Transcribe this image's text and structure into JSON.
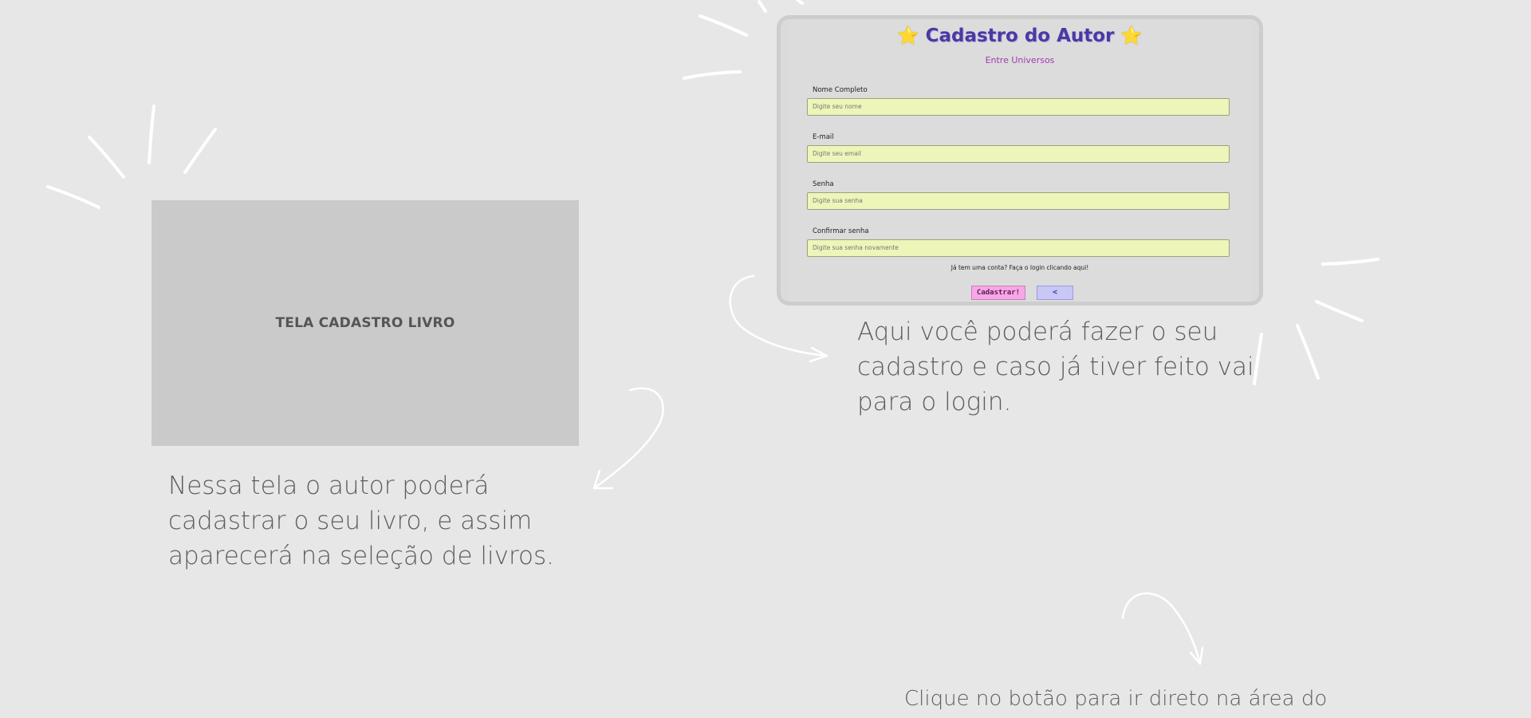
{
  "left_panel": {
    "label": "TELA CADASTRO LIVRO",
    "caption": "Nessa tela o autor poderá cadastrar o seu livro, e assim aparecerá na seleção de livros."
  },
  "preview": {
    "title": "Cadastro do Autor",
    "star_left": "⭐",
    "star_right": "⭐",
    "subtitle": "Entre Universos",
    "fields": [
      {
        "label": "Nome Completo",
        "placeholder": "Digite seu nome"
      },
      {
        "label": "E-mail",
        "placeholder": "Digite seu email"
      },
      {
        "label": "Senha",
        "placeholder": "Digite sua senha"
      },
      {
        "label": "Confirmar senha",
        "placeholder": "Digite sua senha novamente"
      }
    ],
    "login_hint": "Já tem uma conta? Faça o login clicando aqui!",
    "submit_label": "Cadastrar!",
    "back_label": "<"
  },
  "right_caption": "Aqui você poderá fazer o seu cadastro e caso já tiver feito vai para o login.",
  "bottom_caption": "Clique no botão para ir direto na área do",
  "colors": {
    "background": "#e7e7e7",
    "placeholder_panel": "#cacaca",
    "input_fill": "#eef5b9",
    "title": "#4a3aa0",
    "subtitle": "#a23ab0",
    "submit_button": "#f9a6e6",
    "back_button": "#c8c7f5"
  }
}
